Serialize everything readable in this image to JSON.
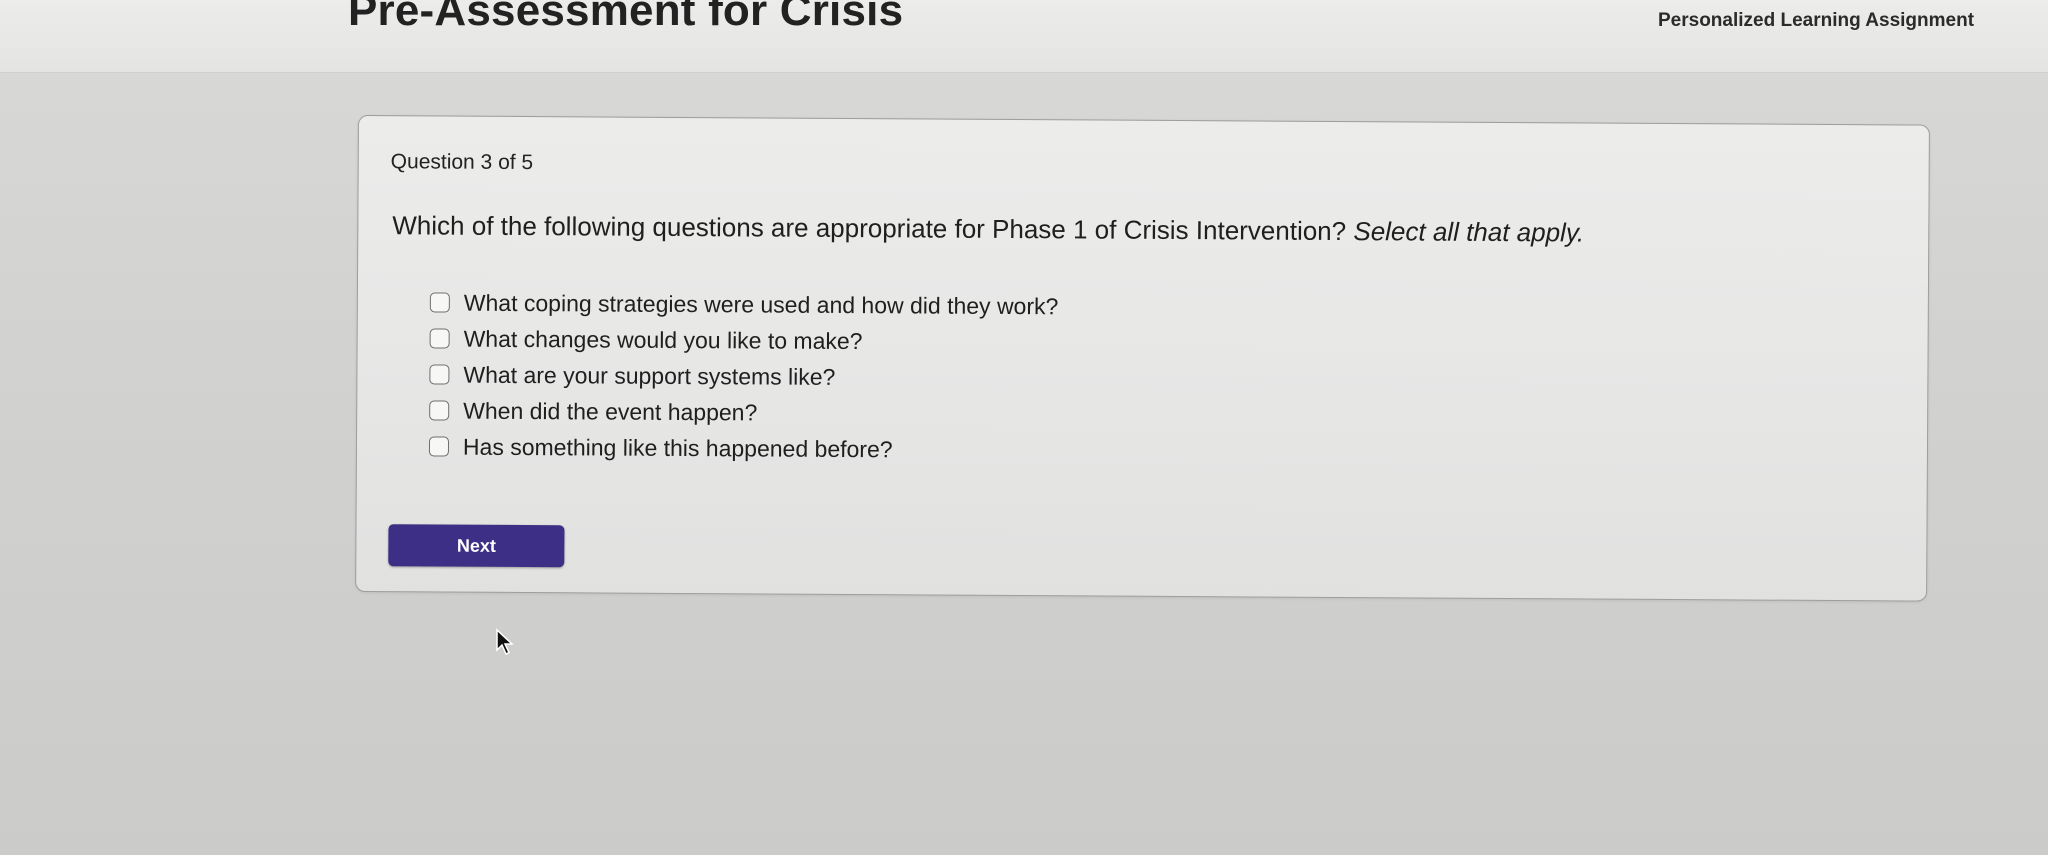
{
  "header": {
    "title": "Pre-Assessment for Crisis",
    "assignment_label": "Personalized Learning Assignment"
  },
  "question": {
    "counter": "Question 3 of 5",
    "text": "Which of the following questions are appropriate for Phase 1 of Crisis Intervention?",
    "instruction": "Select all that apply.",
    "options": [
      {
        "label": "What coping strategies were used and how did they work?",
        "checked": false
      },
      {
        "label": "What changes would you like to make?",
        "checked": false
      },
      {
        "label": "What are your support systems like?",
        "checked": false
      },
      {
        "label": "When did the event happen?",
        "checked": false
      },
      {
        "label": "Has something like this happened before?",
        "checked": false
      }
    ]
  },
  "actions": {
    "next_label": "Next"
  },
  "colors": {
    "button_primary": "#3e2f86",
    "background": "#d2d2d0",
    "card": "#e8e8e7"
  },
  "icons": {
    "cursor": "arrow-cursor-icon"
  }
}
